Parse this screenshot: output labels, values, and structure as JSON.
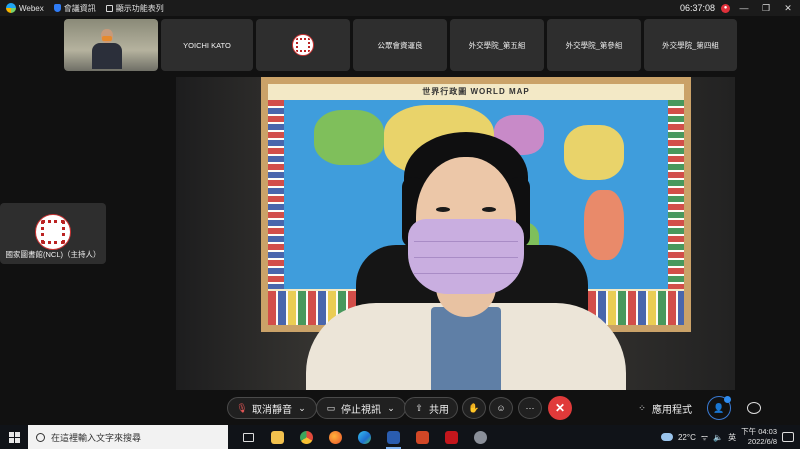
{
  "titlebar": {
    "app_name": "Webex",
    "meeting_info": "會議資訊",
    "show_menu": "顯示功能表列",
    "time": "06:37:08",
    "rec_badge": "●",
    "minimize": "—",
    "restore": "❐",
    "close": "✕"
  },
  "thumbnails": [
    {
      "label": ""
    },
    {
      "label": "YOICHI KATO"
    },
    {
      "label": ""
    },
    {
      "label": "公眾會資運良"
    },
    {
      "label": "外交學院_第五組"
    },
    {
      "label": "外交學院_第參組"
    },
    {
      "label": "外交學院_第四組"
    }
  ],
  "host_tile": {
    "label": "國家圖書館(NCL)（主持人）"
  },
  "main_video": {
    "map_title": "世界行政圖      WORLD MAP"
  },
  "controls": {
    "mute_label": "取消靜音",
    "video_label": "停止視訊",
    "share_label": "共用",
    "more_label": "···",
    "leave_label": "✕",
    "apps_label": "應用程式"
  },
  "taskbar": {
    "search_placeholder": "在這裡輸入文字來搜尋",
    "temperature": "22°C",
    "ime": "英",
    "time": "下午 04:03",
    "date": "2022/6/8"
  },
  "colors": {
    "leave": "#e03a3a",
    "accent": "#2f8cf0",
    "mask": "#c9aee0"
  }
}
